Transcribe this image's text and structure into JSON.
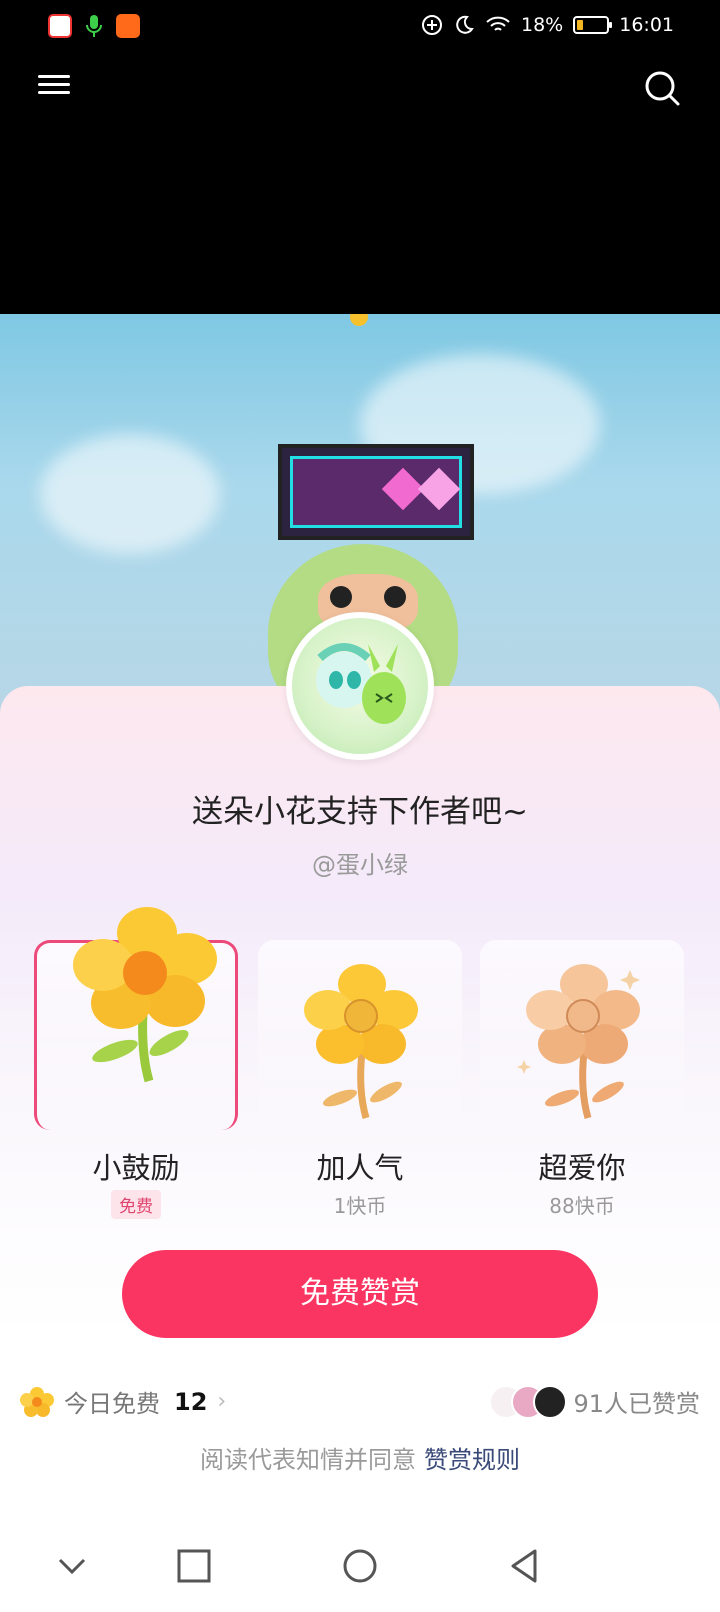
{
  "status_bar": {
    "battery": "18%",
    "time": "16:01",
    "apps": [
      "red-app-icon",
      "mic-icon",
      "kuaishou-icon"
    ]
  },
  "top_bar": {
    "menu_icon": "menu-icon",
    "search_icon": "search-icon"
  },
  "sheet": {
    "title": "送朵小花支持下作者吧~",
    "author": "@蛋小绿",
    "gifts": [
      {
        "name": "小鼓励",
        "price": "免费",
        "selected": true
      },
      {
        "name": "加人气",
        "price": "1快币",
        "selected": false
      },
      {
        "name": "超爱你",
        "price": "88快币",
        "selected": false
      }
    ],
    "cta_label": "免费赞赏",
    "free_today_label": "今日免费",
    "free_today_count": "12",
    "rewarded_text": "91人已赞赏",
    "agreement_text": "阅读代表知情并同意",
    "agreement_link": "赞赏规则"
  },
  "colors": {
    "accent": "#fb3562",
    "selected_border": "#ec4a7a",
    "link": "#3a4a78"
  }
}
